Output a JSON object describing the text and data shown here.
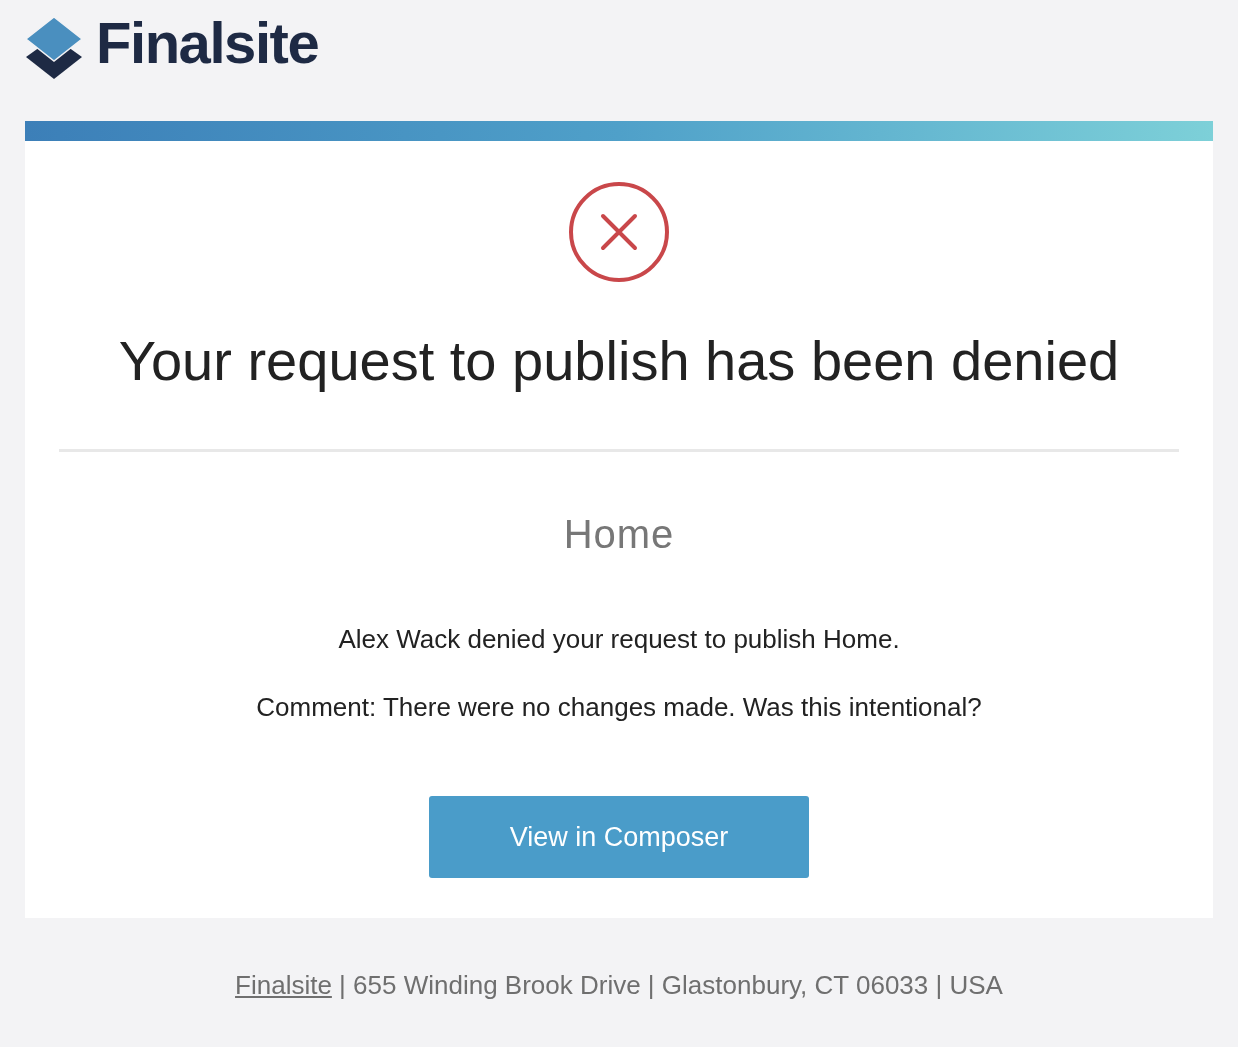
{
  "logo": {
    "text": "Finalsite"
  },
  "card": {
    "kind": "error",
    "title": "Your request to publish has been denied",
    "page_name": "Home",
    "messages": [
      "Alex Wack denied your request to publish Home.",
      "Comment: There were no changes made. Was this intentional?"
    ],
    "button": "View in Composer"
  },
  "footer": {
    "link": "Finalsite",
    "address": " | 655 Winding Brook Drive | Glastonbury, CT 06033 | USA"
  }
}
